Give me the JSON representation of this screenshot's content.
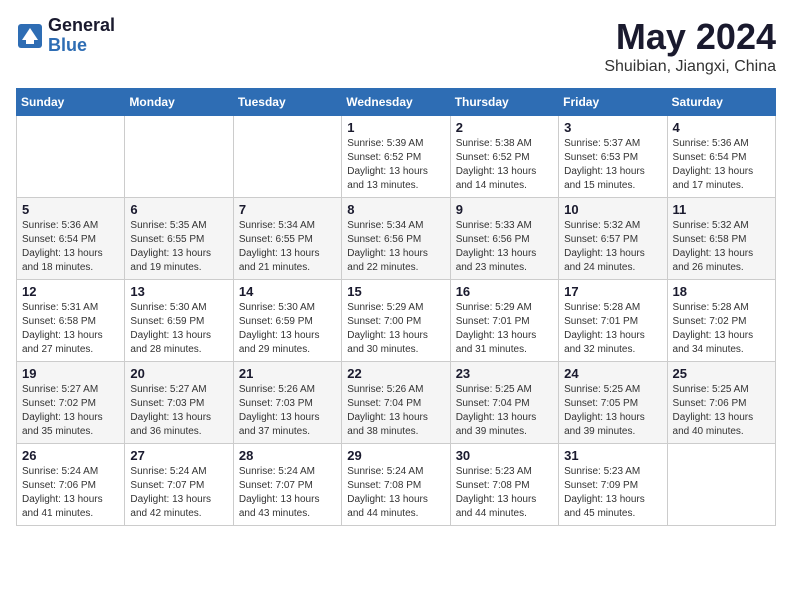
{
  "header": {
    "logo_line1": "General",
    "logo_line2": "Blue",
    "month": "May 2024",
    "location": "Shuibian, Jiangxi, China"
  },
  "weekdays": [
    "Sunday",
    "Monday",
    "Tuesday",
    "Wednesday",
    "Thursday",
    "Friday",
    "Saturday"
  ],
  "weeks": [
    [
      {
        "day": "",
        "info": ""
      },
      {
        "day": "",
        "info": ""
      },
      {
        "day": "",
        "info": ""
      },
      {
        "day": "1",
        "info": "Sunrise: 5:39 AM\nSunset: 6:52 PM\nDaylight: 13 hours\nand 13 minutes."
      },
      {
        "day": "2",
        "info": "Sunrise: 5:38 AM\nSunset: 6:52 PM\nDaylight: 13 hours\nand 14 minutes."
      },
      {
        "day": "3",
        "info": "Sunrise: 5:37 AM\nSunset: 6:53 PM\nDaylight: 13 hours\nand 15 minutes."
      },
      {
        "day": "4",
        "info": "Sunrise: 5:36 AM\nSunset: 6:54 PM\nDaylight: 13 hours\nand 17 minutes."
      }
    ],
    [
      {
        "day": "5",
        "info": "Sunrise: 5:36 AM\nSunset: 6:54 PM\nDaylight: 13 hours\nand 18 minutes."
      },
      {
        "day": "6",
        "info": "Sunrise: 5:35 AM\nSunset: 6:55 PM\nDaylight: 13 hours\nand 19 minutes."
      },
      {
        "day": "7",
        "info": "Sunrise: 5:34 AM\nSunset: 6:55 PM\nDaylight: 13 hours\nand 21 minutes."
      },
      {
        "day": "8",
        "info": "Sunrise: 5:34 AM\nSunset: 6:56 PM\nDaylight: 13 hours\nand 22 minutes."
      },
      {
        "day": "9",
        "info": "Sunrise: 5:33 AM\nSunset: 6:56 PM\nDaylight: 13 hours\nand 23 minutes."
      },
      {
        "day": "10",
        "info": "Sunrise: 5:32 AM\nSunset: 6:57 PM\nDaylight: 13 hours\nand 24 minutes."
      },
      {
        "day": "11",
        "info": "Sunrise: 5:32 AM\nSunset: 6:58 PM\nDaylight: 13 hours\nand 26 minutes."
      }
    ],
    [
      {
        "day": "12",
        "info": "Sunrise: 5:31 AM\nSunset: 6:58 PM\nDaylight: 13 hours\nand 27 minutes."
      },
      {
        "day": "13",
        "info": "Sunrise: 5:30 AM\nSunset: 6:59 PM\nDaylight: 13 hours\nand 28 minutes."
      },
      {
        "day": "14",
        "info": "Sunrise: 5:30 AM\nSunset: 6:59 PM\nDaylight: 13 hours\nand 29 minutes."
      },
      {
        "day": "15",
        "info": "Sunrise: 5:29 AM\nSunset: 7:00 PM\nDaylight: 13 hours\nand 30 minutes."
      },
      {
        "day": "16",
        "info": "Sunrise: 5:29 AM\nSunset: 7:01 PM\nDaylight: 13 hours\nand 31 minutes."
      },
      {
        "day": "17",
        "info": "Sunrise: 5:28 AM\nSunset: 7:01 PM\nDaylight: 13 hours\nand 32 minutes."
      },
      {
        "day": "18",
        "info": "Sunrise: 5:28 AM\nSunset: 7:02 PM\nDaylight: 13 hours\nand 34 minutes."
      }
    ],
    [
      {
        "day": "19",
        "info": "Sunrise: 5:27 AM\nSunset: 7:02 PM\nDaylight: 13 hours\nand 35 minutes."
      },
      {
        "day": "20",
        "info": "Sunrise: 5:27 AM\nSunset: 7:03 PM\nDaylight: 13 hours\nand 36 minutes."
      },
      {
        "day": "21",
        "info": "Sunrise: 5:26 AM\nSunset: 7:03 PM\nDaylight: 13 hours\nand 37 minutes."
      },
      {
        "day": "22",
        "info": "Sunrise: 5:26 AM\nSunset: 7:04 PM\nDaylight: 13 hours\nand 38 minutes."
      },
      {
        "day": "23",
        "info": "Sunrise: 5:25 AM\nSunset: 7:04 PM\nDaylight: 13 hours\nand 39 minutes."
      },
      {
        "day": "24",
        "info": "Sunrise: 5:25 AM\nSunset: 7:05 PM\nDaylight: 13 hours\nand 39 minutes."
      },
      {
        "day": "25",
        "info": "Sunrise: 5:25 AM\nSunset: 7:06 PM\nDaylight: 13 hours\nand 40 minutes."
      }
    ],
    [
      {
        "day": "26",
        "info": "Sunrise: 5:24 AM\nSunset: 7:06 PM\nDaylight: 13 hours\nand 41 minutes."
      },
      {
        "day": "27",
        "info": "Sunrise: 5:24 AM\nSunset: 7:07 PM\nDaylight: 13 hours\nand 42 minutes."
      },
      {
        "day": "28",
        "info": "Sunrise: 5:24 AM\nSunset: 7:07 PM\nDaylight: 13 hours\nand 43 minutes."
      },
      {
        "day": "29",
        "info": "Sunrise: 5:24 AM\nSunset: 7:08 PM\nDaylight: 13 hours\nand 44 minutes."
      },
      {
        "day": "30",
        "info": "Sunrise: 5:23 AM\nSunset: 7:08 PM\nDaylight: 13 hours\nand 44 minutes."
      },
      {
        "day": "31",
        "info": "Sunrise: 5:23 AM\nSunset: 7:09 PM\nDaylight: 13 hours\nand 45 minutes."
      },
      {
        "day": "",
        "info": ""
      }
    ]
  ]
}
